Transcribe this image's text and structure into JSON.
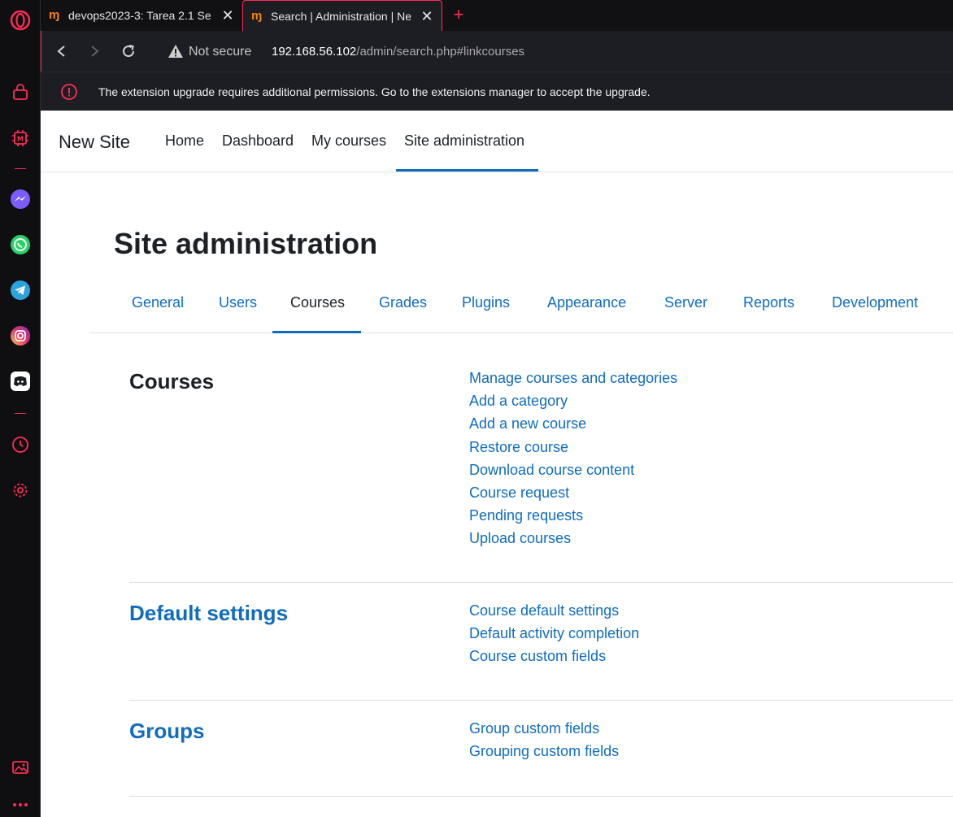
{
  "browser": {
    "tabs": [
      {
        "title": "devops2023-3: Tarea 2.1 Se",
        "icon": "moodle-icon",
        "active": false
      },
      {
        "title": "Search | Administration | Ne",
        "icon": "moodle-icon",
        "active": true
      }
    ],
    "new_tab": "+",
    "security": "Not secure",
    "url_host": "192.168.56.102",
    "url_path": "/admin/search.php#linkcourses",
    "banner": "The extension upgrade requires additional permissions. Go to the extensions manager to accept the upgrade.",
    "accent_color": "#ff2d55"
  },
  "sidebar": {
    "icons": [
      "opera-logo",
      "bag-icon",
      "aria-icon",
      "messenger-icon",
      "whatsapp-icon",
      "telegram-icon",
      "instagram-icon",
      "discord-icon",
      "history-icon",
      "settings-icon",
      "snapshot-icon",
      "more-icon"
    ]
  },
  "site": {
    "name": "New Site",
    "nav": [
      "Home",
      "Dashboard",
      "My courses",
      "Site administration"
    ],
    "active_nav": "Site administration"
  },
  "page": {
    "title": "Site administration",
    "tabs": [
      "General",
      "Users",
      "Courses",
      "Grades",
      "Plugins",
      "Appearance",
      "Server",
      "Reports",
      "Development"
    ],
    "active_tab": "Courses",
    "link_color": "#0f6cbf",
    "sections": [
      {
        "heading": "Courses",
        "links": [
          "Manage courses and categories",
          "Add a category",
          "Add a new course",
          "Restore course",
          "Download course content",
          "Course request",
          "Pending requests",
          "Upload courses"
        ]
      },
      {
        "heading": "Default settings",
        "links": [
          "Course default settings",
          "Default activity completion",
          "Course custom fields"
        ]
      },
      {
        "heading": "Groups",
        "links": [
          "Group custom fields",
          "Grouping custom fields"
        ]
      }
    ]
  }
}
